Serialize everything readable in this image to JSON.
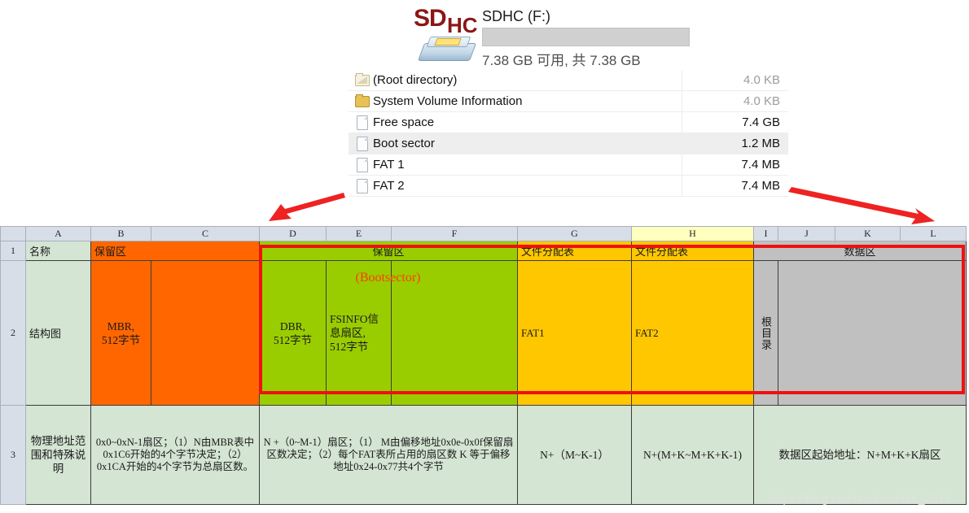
{
  "explorer": {
    "logo_primary": "SD",
    "logo_secondary": "HC",
    "drive_title": "SDHC (F:)",
    "capacity_text": "7.38 GB 可用, 共 7.38 GB",
    "files": [
      {
        "icon": "folder-open-icon",
        "name": "(Root directory)",
        "size": "4.0 KB",
        "dim": true,
        "selected": false
      },
      {
        "icon": "folder-icon",
        "name": "System Volume Information",
        "size": "4.0 KB",
        "dim": true,
        "selected": false
      },
      {
        "icon": "file-icon",
        "name": "Free space",
        "size": "7.4 GB",
        "dim": false,
        "selected": false
      },
      {
        "icon": "file-icon",
        "name": "Boot sector",
        "size": "1.2 MB",
        "dim": false,
        "selected": true
      },
      {
        "icon": "file-icon",
        "name": "FAT 1",
        "size": "7.4 MB",
        "dim": false,
        "selected": false
      },
      {
        "icon": "file-icon",
        "name": "FAT 2",
        "size": "7.4 MB",
        "dim": false,
        "selected": false
      }
    ]
  },
  "sheet": {
    "column_headers": [
      "A",
      "B",
      "C",
      "D",
      "E",
      "F",
      "G",
      "H",
      "I",
      "J",
      "K",
      "L"
    ],
    "selected_column": "H",
    "row_headers": [
      "1",
      "2",
      "3"
    ],
    "row1": {
      "a": "名称",
      "bc": "保留区",
      "def": "保留区",
      "g": "文件分配表",
      "h": "文件分配表",
      "ijkl": "数据区"
    },
    "row2": {
      "a": "结构图",
      "b": "MBR,\n512字节",
      "c": "",
      "bootsector_label": "(Bootsector)",
      "d": "DBR,\n512字节",
      "e": "FSINFO信\n息扇区,\n512字节",
      "f": "",
      "g": "FAT1",
      "h": "FAT2",
      "i": "根目录",
      "jkl": ""
    },
    "row3": {
      "a": "物理地址范围和特殊说明",
      "bc": "0x0~0xN-1扇区；（1）N由MBR表中0x1C6开始的4个字节决定；（2）0x1CA开始的4个字节为总扇区数。",
      "def": "N +（0~M-1）扇区；（1） M由偏移地址0x0e-0x0f保留扇区数决定；（2）每个FAT表所占用的扇区数 K 等于偏移地址0x24-0x77共4个字节",
      "g": "N+（M~K-1）",
      "h": "N+(M+K~M+K+K-1)",
      "ijkl": "数据区起始地址：N+M+K+K扇区"
    }
  },
  "watermark": "https://blog.csdn.net/csdn66_2016",
  "colors": {
    "orange": "#ff6600",
    "green": "#9acd00",
    "gold": "#ffc700",
    "gray": "#c0c0c0",
    "light_green": "#d4e5d3",
    "red_accent": "#ee1111",
    "bootsector_text": "#ff3c00",
    "header_selected": "#ffffbe"
  }
}
